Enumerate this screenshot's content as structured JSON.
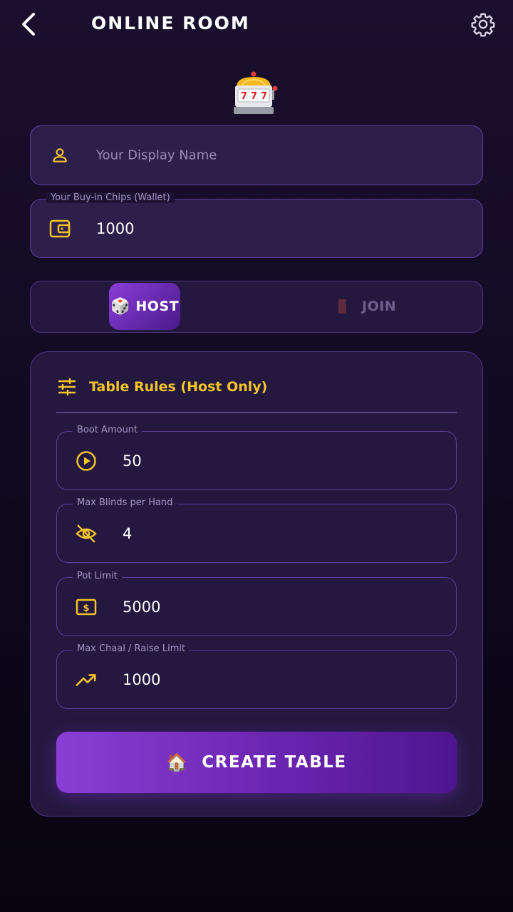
{
  "header": {
    "title": "ONLINE ROOM",
    "back_icon": "chevron-left-icon",
    "settings_icon": "gear-icon"
  },
  "logo": {
    "icon": "slot-machine-icon"
  },
  "display_name": {
    "placeholder": "Your Display Name",
    "value": "",
    "icon": "person-icon"
  },
  "buy_in": {
    "label": "Your Buy-in Chips (Wallet)",
    "value": "1000",
    "icon": "wallet-icon"
  },
  "mode_toggle": {
    "host_label": "HOST",
    "join_label": "JOIN",
    "selected": "HOST"
  },
  "rules": {
    "title": "Table Rules (Host Only)",
    "fields": [
      {
        "label": "Boot Amount",
        "value": "50",
        "icon": "play-circle-icon"
      },
      {
        "label": "Max Blinds per Hand",
        "value": "4",
        "icon": "eye-off-icon"
      },
      {
        "label": "Pot Limit",
        "value": "5000",
        "icon": "dollar-bill-icon"
      },
      {
        "label": "Max Chaal / Raise Limit",
        "value": "1000",
        "icon": "trending-up-icon"
      }
    ]
  },
  "create_button": {
    "label": "CREATE TABLE",
    "icon": "house-icon"
  },
  "colors": {
    "accent_gold": "#f5c526",
    "accent_purple": "#8a3dd8",
    "field_bg": "#2d1f4c",
    "border": "#5c3f9a"
  }
}
